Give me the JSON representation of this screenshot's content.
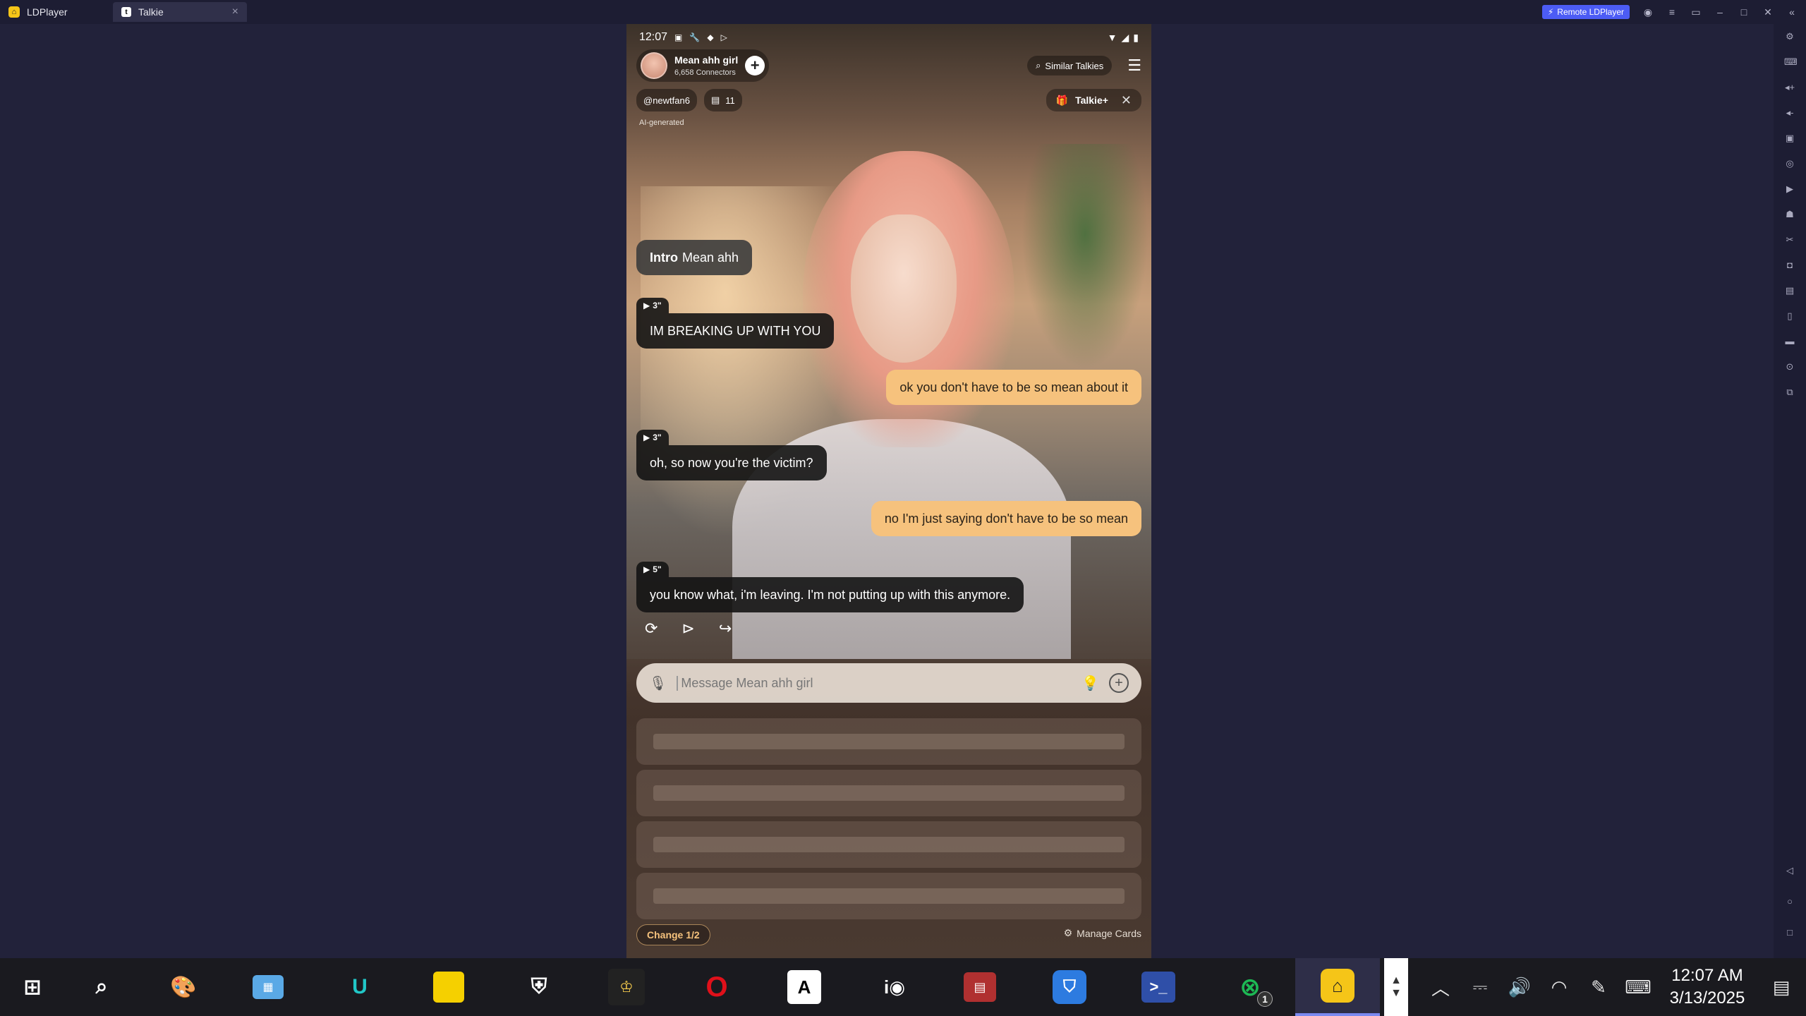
{
  "window": {
    "tabs": [
      {
        "label": "LDPlayer"
      },
      {
        "label": "Talkie"
      }
    ],
    "remote_label": "Remote LDPlayer"
  },
  "phone": {
    "status_time": "12:07",
    "character": {
      "name": "Mean ahh girl",
      "connectors": "6,658 Connectors"
    },
    "similar_label": "Similar Talkies",
    "creator": "@newtfan6",
    "comment_count": "11",
    "talkie_plus_label": "Talkie+",
    "ai_generated": "AI-generated",
    "intro": {
      "tag": "Intro",
      "text": "Mean ahh"
    },
    "messages": [
      {
        "role": "char",
        "duration": "3\"",
        "text": "IM BREAKING UP WITH YOU"
      },
      {
        "role": "user",
        "text": "ok you don't have to be so mean about it"
      },
      {
        "role": "char",
        "duration": "3\"",
        "text": "oh, so now you're the victim?"
      },
      {
        "role": "user",
        "text": "no I'm just saying don't have to be so mean"
      },
      {
        "role": "char",
        "duration": "5\"",
        "text": "you know what, i'm leaving. I'm not putting up with this anymore."
      }
    ],
    "input_placeholder": "Message Mean ahh girl",
    "change_label": "Change 1/2",
    "manage_label": "Manage Cards"
  },
  "taskbar": {
    "clock_time": "12:07 AM",
    "clock_date": "3/13/2025",
    "xbox_badge": "1"
  },
  "colors": {
    "user_bubble": "#f6c27d",
    "char_bubble": "#141414",
    "accent": "#4c5cf5"
  }
}
